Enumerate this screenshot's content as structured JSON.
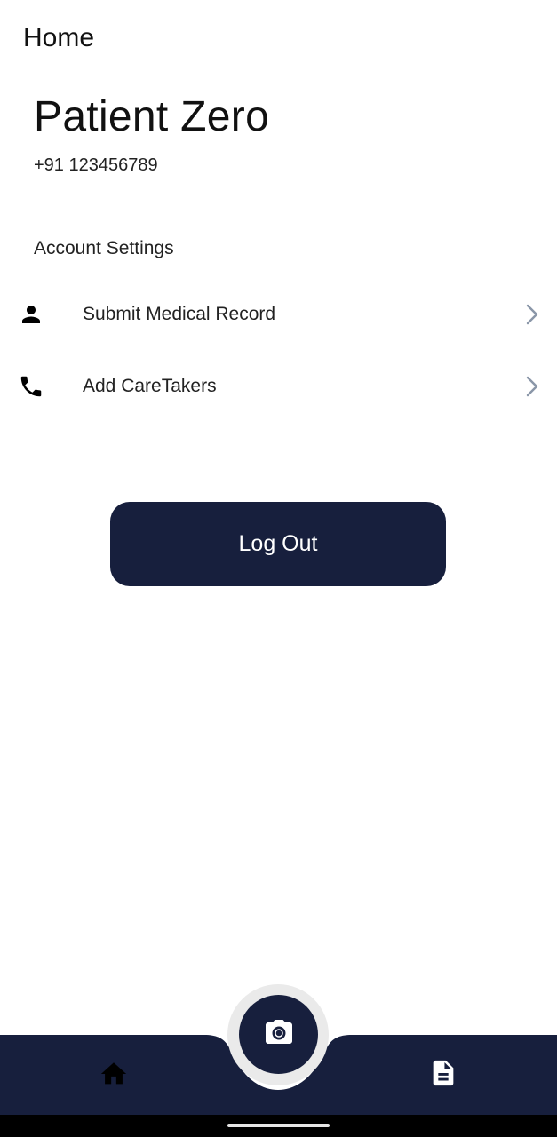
{
  "app_bar": {
    "title": "Home"
  },
  "profile": {
    "name": "Patient Zero",
    "phone": "+91 123456789"
  },
  "settings": {
    "section_title": "Account Settings",
    "items": [
      {
        "label": "Submit Medical Record",
        "icon": "person-icon"
      },
      {
        "label": "Add CareTakers",
        "icon": "phone-icon"
      }
    ]
  },
  "logout": {
    "label": "Log Out"
  },
  "bottom_nav": {
    "items": [
      {
        "icon": "home-icon"
      },
      {
        "icon": "camera-icon"
      },
      {
        "icon": "document-icon"
      }
    ]
  },
  "colors": {
    "primary": "#171f3d",
    "chevron": "#8a96a8",
    "background": "#ffffff"
  }
}
